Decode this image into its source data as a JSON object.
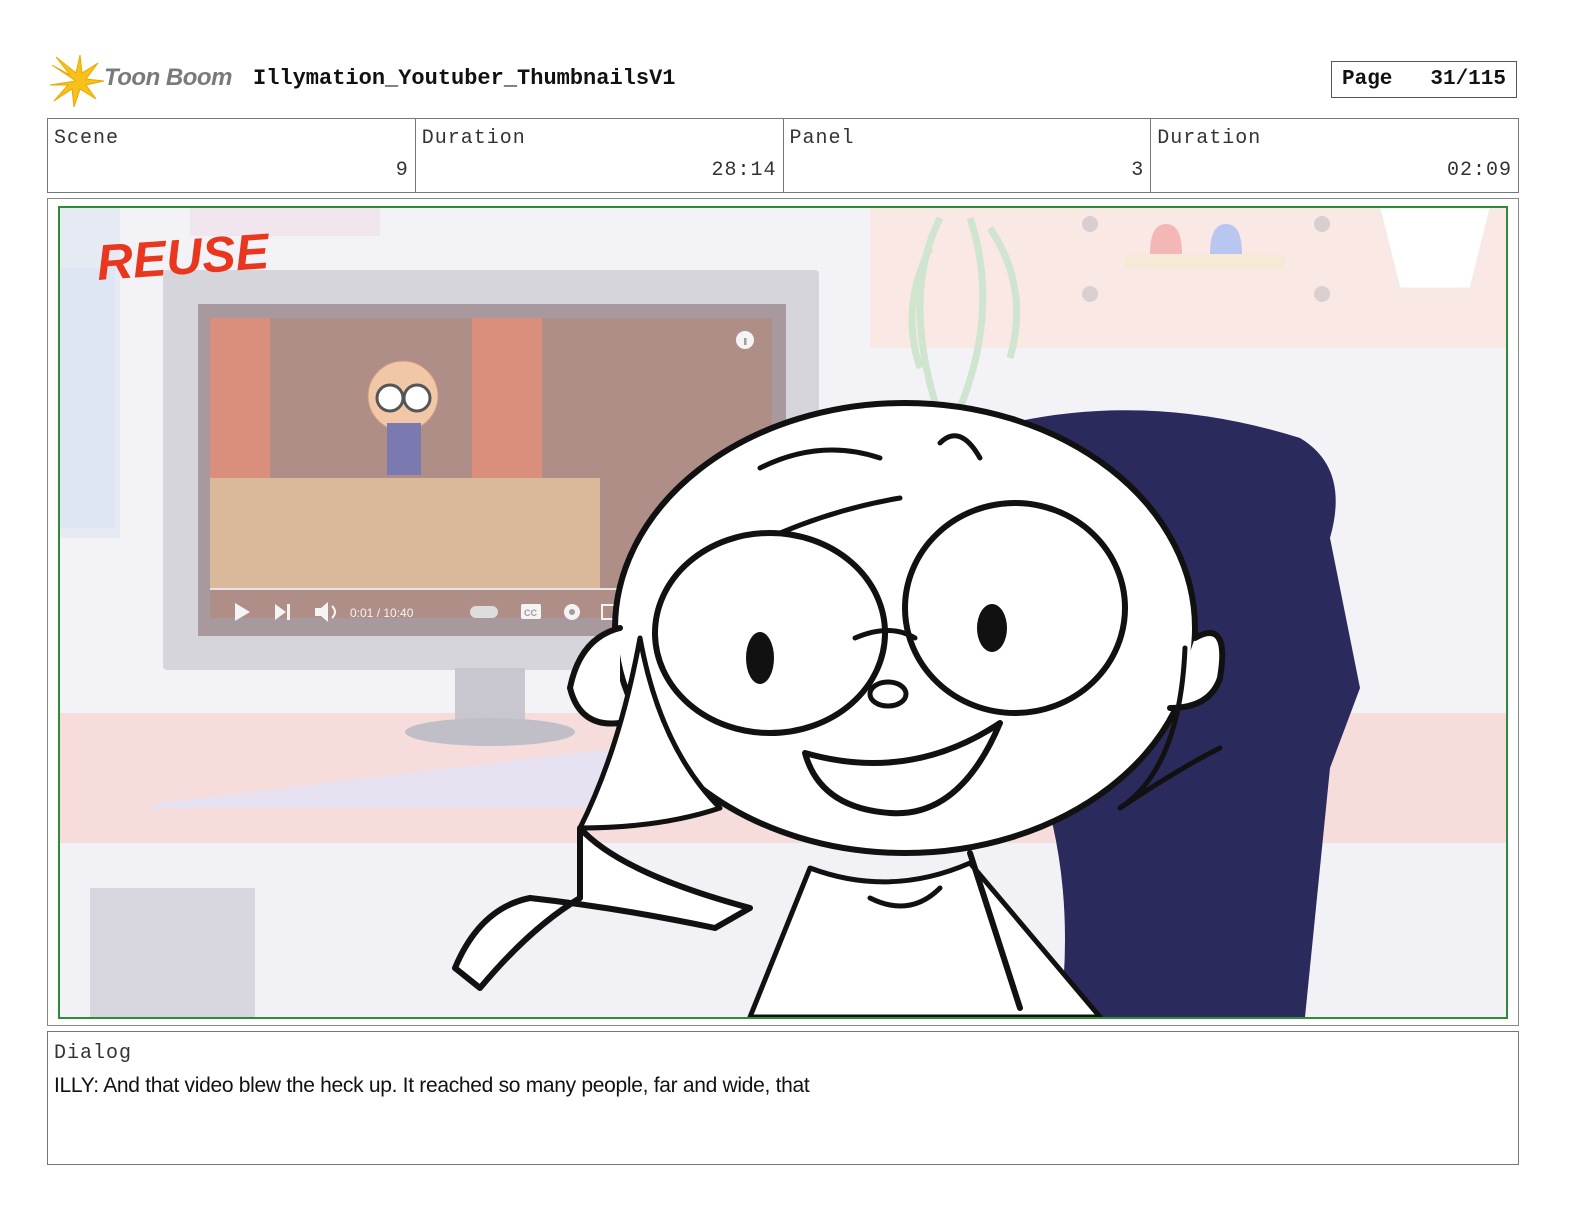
{
  "header": {
    "logo_text": "Toon Boom",
    "project_title": "Illymation_Youtuber_ThumbnailsV1",
    "page_label": "Page",
    "page_number": "31/115"
  },
  "info": {
    "scene_label": "Scene",
    "scene_value": "9",
    "scene_duration_label": "Duration",
    "scene_duration_value": "28:14",
    "panel_label": "Panel",
    "panel_value": "3",
    "panel_duration_label": "Duration",
    "panel_duration_value": "02:09"
  },
  "panel_art": {
    "stamp_text": "REUSE",
    "video_time": "0:01 / 10:40",
    "icons": [
      "play-icon",
      "skip-next-icon",
      "volume-icon",
      "autoplay-toggle-icon",
      "captions-icon",
      "settings-icon",
      "miniplayer-icon",
      "info-icon"
    ]
  },
  "dialog": {
    "label": "Dialog",
    "text": "ILLY: And that video blew the heck up. It reached so many people, far and wide, that"
  },
  "colors": {
    "frame_border": "#2e8b3a",
    "reuse_red": "#e8371e",
    "chair_navy": "#2b2a5c"
  }
}
